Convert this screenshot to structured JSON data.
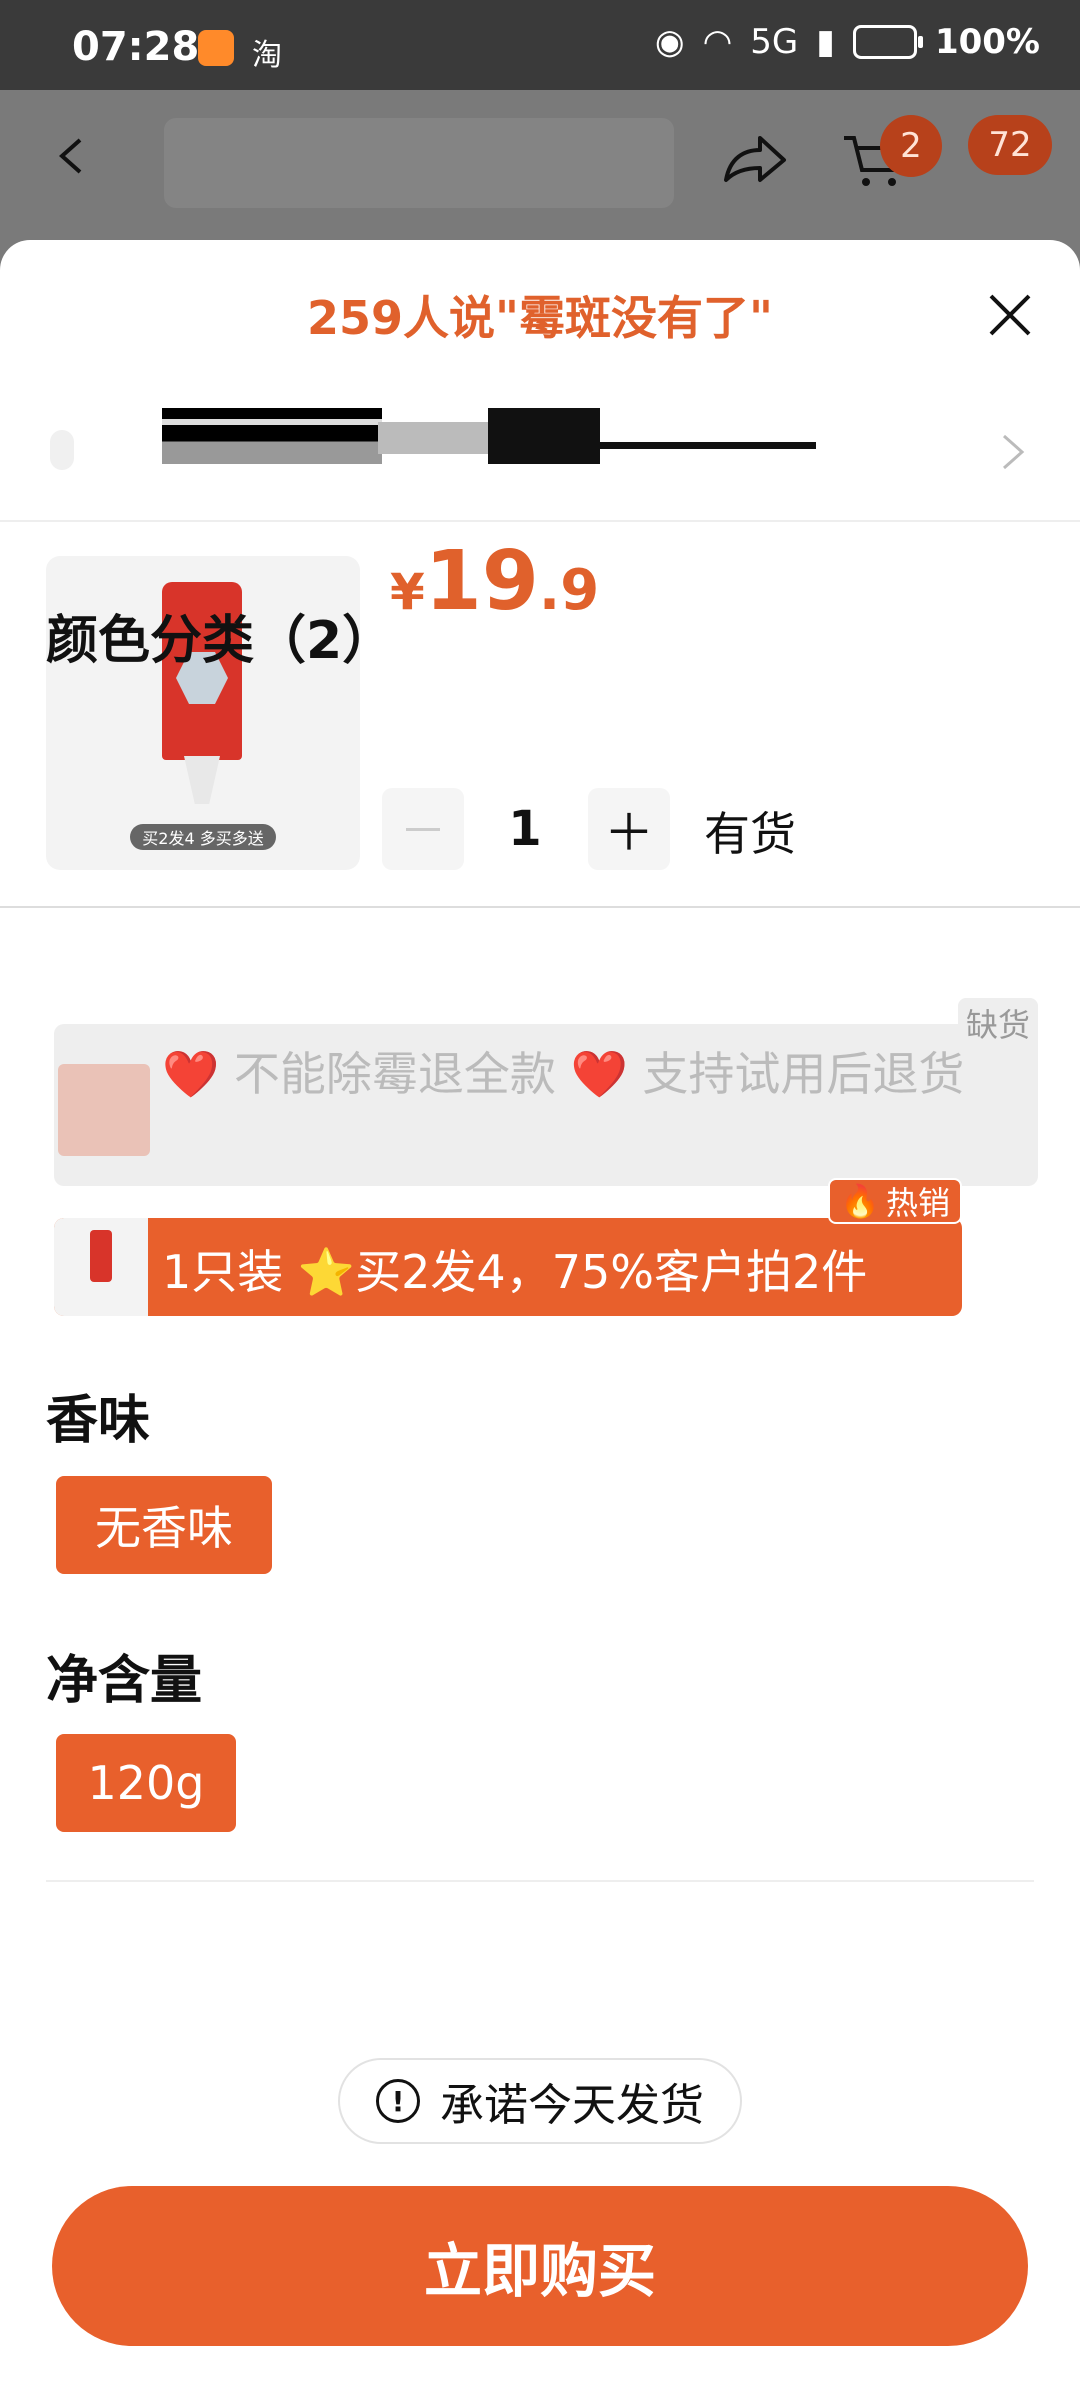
{
  "status_bar": {
    "time": "07:28",
    "app_icon_taobao": "淘",
    "network": "5G",
    "battery": "100%"
  },
  "header": {
    "cart_count": "2",
    "more_count": "72"
  },
  "sheet": {
    "title": "259人说\"霉斑没有了\"",
    "price": {
      "currency": "¥",
      "integer": "19",
      "decimal": ".9"
    },
    "product_image_tag": "买2发4 多买多送",
    "quantity": "1",
    "stock_status": "有货",
    "sections": {
      "color": {
        "title": "颜色分类（2）",
        "options": [
          {
            "label": "❤️ 不能除霉退全款 ❤️ 支持试用后退货",
            "badge": "缺货",
            "state": "disabled"
          },
          {
            "label": "1只装 ⭐买2发4，75%客户拍2件",
            "badge": "热销",
            "state": "selected"
          }
        ]
      },
      "scent": {
        "title": "香味",
        "options": [
          {
            "label": "无香味",
            "state": "selected"
          }
        ]
      },
      "net": {
        "title": "净含量",
        "options": [
          {
            "label": "120g",
            "state": "selected"
          }
        ]
      }
    },
    "shipping_promise": "承诺今天发货",
    "buy_button": "立即购买"
  },
  "colors": {
    "accent": "#e8602c",
    "title_orange": "#e0612c"
  }
}
